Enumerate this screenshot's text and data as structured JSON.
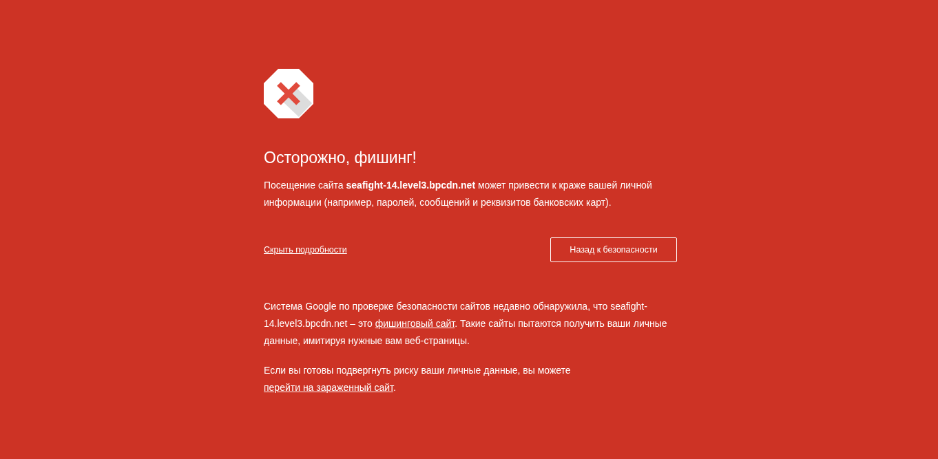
{
  "title": "Осторожно, фишинг!",
  "intro": "Посещение сайта **seafight-14.level3.bpcdn.net** может привести к краже вашей личной информации (например, паролей, сообщений и реквизитов банковских карт).",
  "details_link": "Скрыть подробности",
  "back_button": "Назад к безопасности",
  "details": [
    [
      {
        "kind": "text",
        "text": "Система Google по проверке безопасности сайтов недавно обнаружила, что seafight-14.level3.bpcdn.net – это "
      },
      {
        "kind": "link",
        "text": "фишинговый сайт"
      },
      {
        "kind": "text",
        "text": ". Такие сайты пытаются получить ваши личные данные, имитируя нужные вам веб-страницы."
      }
    ],
    [
      {
        "kind": "text",
        "text": "Если вы готовы подвергнуть риску ваши личные данные, вы можете "
      },
      {
        "kind": "link",
        "text": "перейти на зараженный сайт"
      },
      {
        "kind": "text",
        "text": "."
      }
    ]
  ]
}
